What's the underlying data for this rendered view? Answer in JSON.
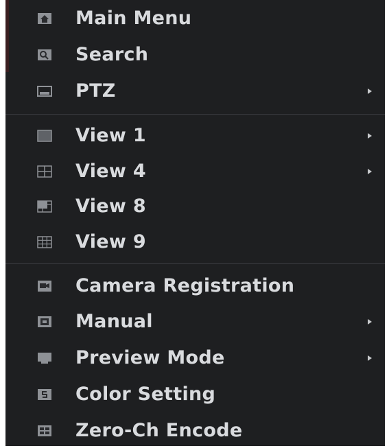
{
  "menu": {
    "items": [
      {
        "label": "Main Menu",
        "icon": "home-icon",
        "submenu": false
      },
      {
        "label": "Search",
        "icon": "search-icon",
        "submenu": false
      },
      {
        "label": "PTZ",
        "icon": "ptz-camera-icon",
        "submenu": true
      },
      {
        "label": "View 1",
        "icon": "single-view-icon",
        "submenu": true
      },
      {
        "label": "View 4",
        "icon": "quad-view-icon",
        "submenu": true
      },
      {
        "label": "View 8",
        "icon": "eight-view-icon",
        "submenu": false
      },
      {
        "label": "View 9",
        "icon": "nine-view-icon",
        "submenu": false
      },
      {
        "label": "Camera Registration",
        "icon": "camera-registration-icon",
        "submenu": false
      },
      {
        "label": "Manual",
        "icon": "manual-icon",
        "submenu": true
      },
      {
        "label": "Preview Mode",
        "icon": "preview-mode-icon",
        "submenu": true
      },
      {
        "label": "Color Setting",
        "icon": "color-setting-icon",
        "submenu": false
      },
      {
        "label": "Zero-Ch Encode",
        "icon": "zero-channel-encode-icon",
        "submenu": false
      }
    ]
  },
  "colors": {
    "menu_background": "#1e1f21",
    "text": "#d9dbde",
    "icon": "#9a9da2",
    "divider": "#3a3c40"
  }
}
